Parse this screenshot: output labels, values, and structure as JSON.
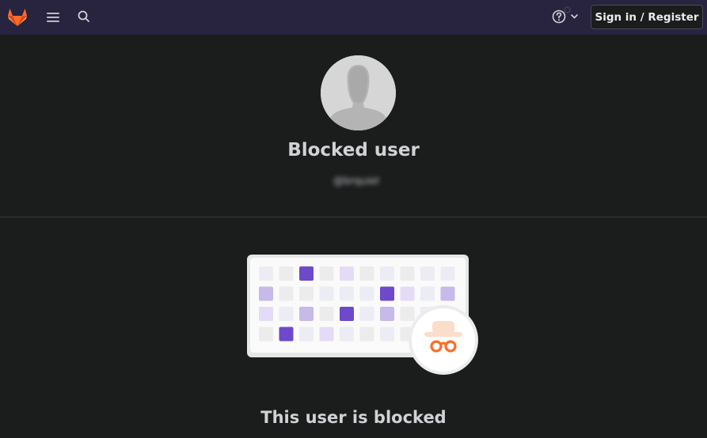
{
  "navbar": {
    "logo_icon": "gitlab-tanuki-icon",
    "menu_icon": "hamburger-menu-icon",
    "search_icon": "search-icon",
    "help_icon": "question-circle-icon",
    "help_caret_icon": "chevron-down-icon",
    "signin_label": "Sign in / Register"
  },
  "profile": {
    "avatar_icon": "default-avatar-silhouette",
    "name": "Blocked user",
    "username": "@brquiel"
  },
  "empty_state": {
    "illustration_icon": "contribution-grid-incognito-illustration",
    "title": "This user is blocked"
  },
  "colors": {
    "navbar_bg": "#28233f",
    "page_bg": "#1b1c1c",
    "accent_purple": "#6e49cb",
    "incognito_orange": "#fc6d26"
  }
}
